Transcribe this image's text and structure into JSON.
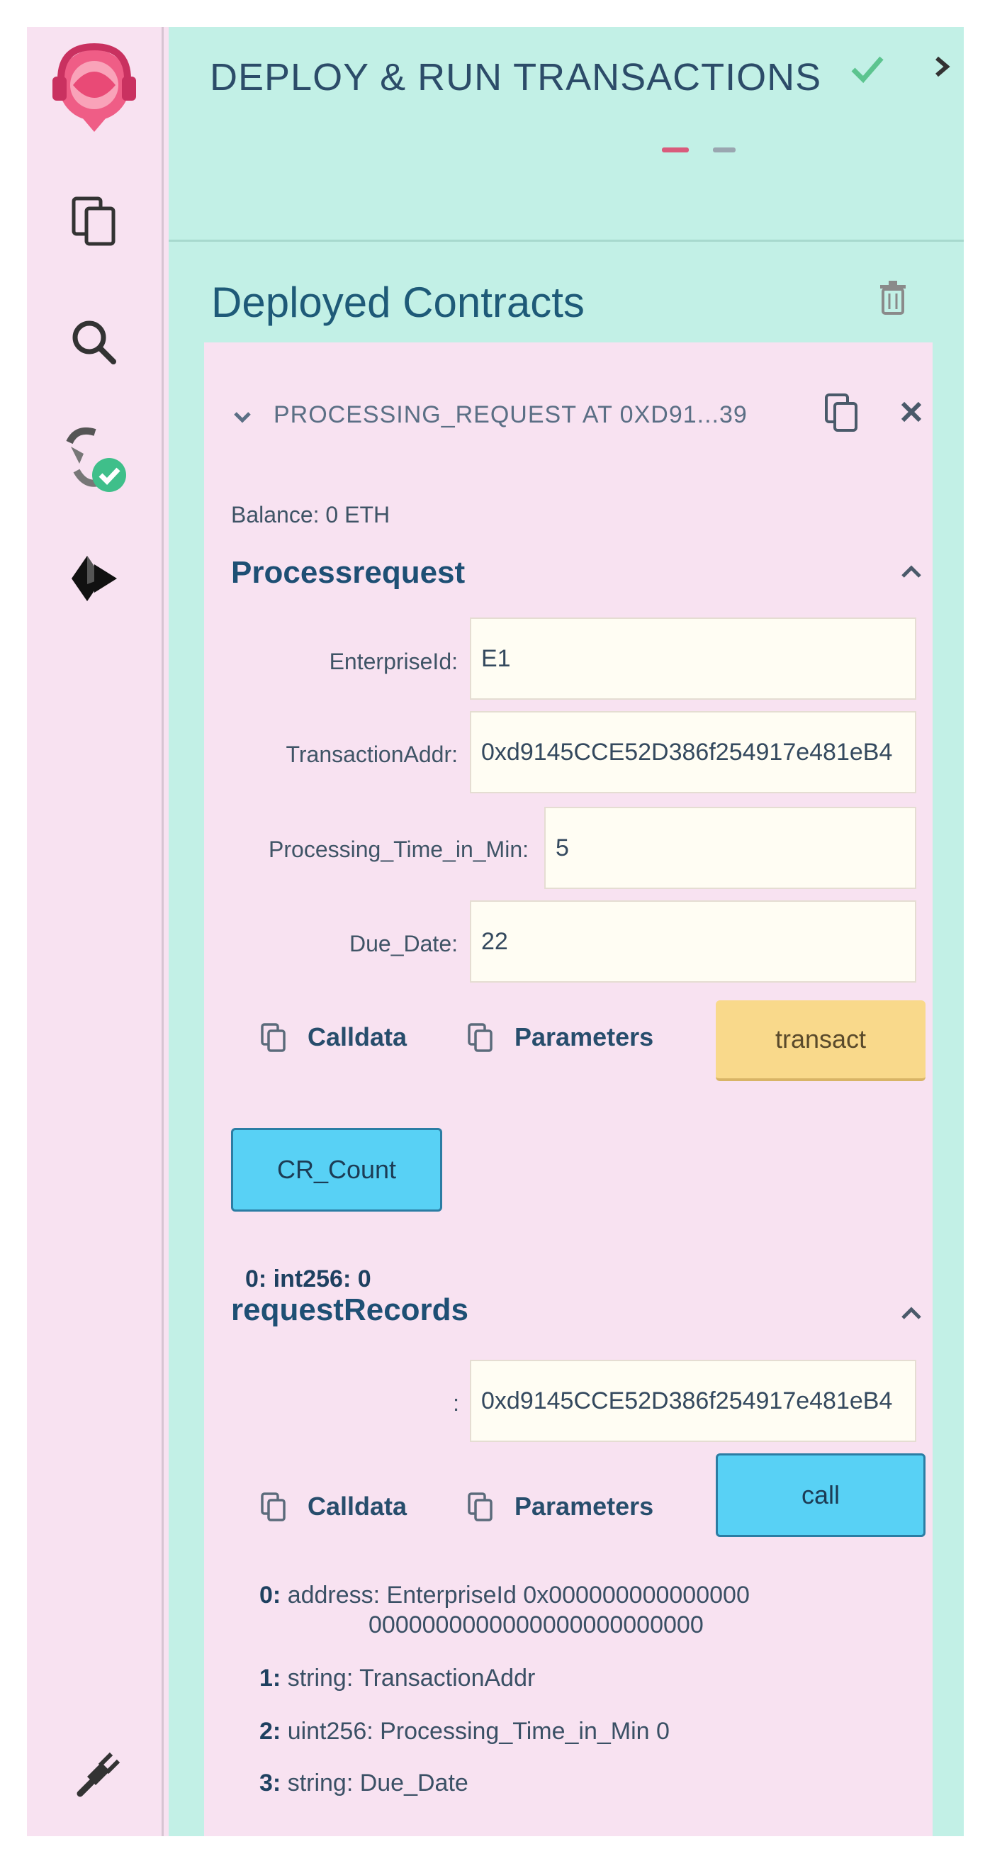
{
  "header": {
    "title": "DEPLOY & RUN TRANSACTIONS"
  },
  "deployed": {
    "title": "Deployed Contracts",
    "contract_label": "PROCESSING_REQUEST AT 0XD91...39",
    "balance": "Balance: 0 ETH"
  },
  "processrequest": {
    "title": "Processrequest",
    "fields": [
      {
        "label": "EnterpriseId:",
        "value": "E1"
      },
      {
        "label": "TransactionAddr:",
        "value": "0xd9145CCE52D386f254917e481eB4"
      },
      {
        "label": "Processing_Time_in_Min:",
        "value": "5"
      },
      {
        "label": "Due_Date:",
        "value": "22"
      }
    ],
    "calldata_label": "Calldata",
    "parameters_label": "Parameters",
    "transact_label": "transact"
  },
  "cr_count": {
    "button_label": "CR_Count",
    "result": "0: int256: 0"
  },
  "request_records": {
    "title": "requestRecords",
    "input_label": ":",
    "input_value": "0xd9145CCE52D386f254917e481eB4",
    "calldata_label": "Calldata",
    "parameters_label": "Parameters",
    "call_label": "call",
    "outputs": [
      {
        "key": "0:",
        "text": "address: EnterpriseId 0x000000000000000",
        "cont": "0000000000000000000000000"
      },
      {
        "key": "1:",
        "text": "string: TransactionAddr"
      },
      {
        "key": "2:",
        "text": "uint256: Processing_Time_in_Min 0"
      },
      {
        "key": "3:",
        "text": "string: Due_Date"
      }
    ]
  },
  "colors": {
    "rail_bg": "#f8e2f1",
    "panel_bg": "#c2f0e6",
    "transact_button": "#f9d98b",
    "call_button": "#58d1f5",
    "accent_check": "#3fbf8a"
  }
}
